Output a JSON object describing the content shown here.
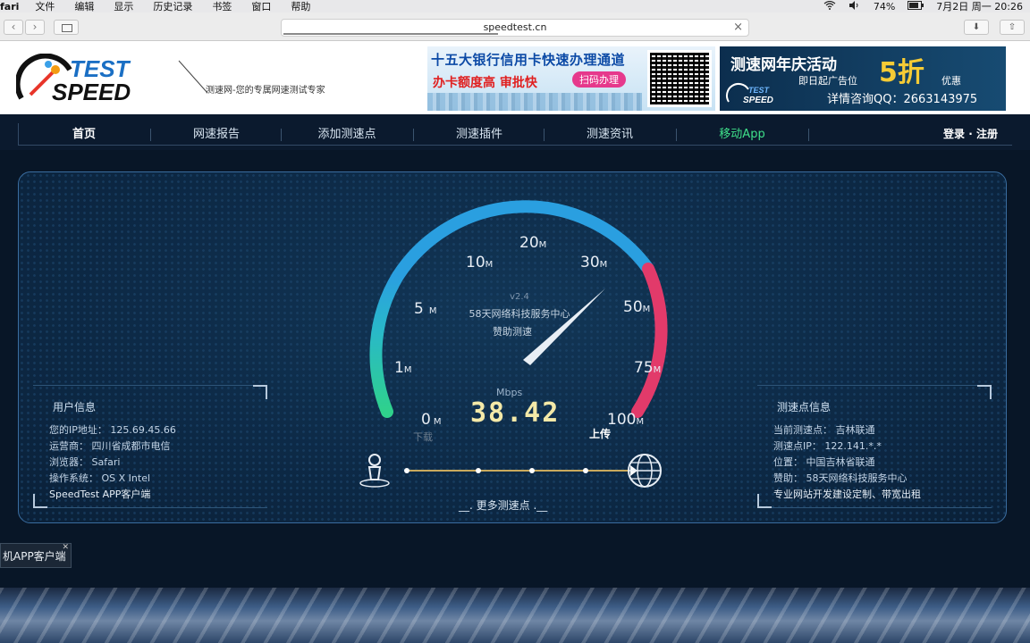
{
  "menubar": {
    "items": [
      "fari",
      "文件",
      "编辑",
      "显示",
      "历史记录",
      "书签",
      "窗口",
      "帮助"
    ],
    "battery": "74%",
    "datetime": "7月2日 周一  20:26"
  },
  "browser": {
    "url": "speedtest.cn"
  },
  "site": {
    "slogan": "测速网-您的专属网速测试专家",
    "logo_line1": "TEST",
    "logo_line2": "SPEED"
  },
  "ads": {
    "ad1_title": "十五大银行信用卡快速办理通道",
    "ad1_sub": "办卡额度高 审批快",
    "ad1_button": "扫码办理",
    "ad2_title": "测速网年庆活动",
    "ad2_sub": "即日起广告位",
    "ad2_discount": "5折",
    "ad2_discount_suffix": "优惠",
    "ad2_contact": "详情咨询QQ：2663143975"
  },
  "nav": {
    "items": [
      "首页",
      "网速报告",
      "添加测速点",
      "测速插件",
      "测速资讯",
      "移动App"
    ],
    "login": "登录",
    "register": "注册"
  },
  "gauge": {
    "version": "v2.4",
    "sponsor_line1": "58天网络科技服务中心",
    "sponsor_line2": "赞助测速",
    "unit": "Mbps",
    "speed": "38.42",
    "download_label": "下载",
    "upload_label": "上传",
    "ticks": [
      {
        "num": "0",
        "unit": "M"
      },
      {
        "num": "1",
        "unit": "M"
      },
      {
        "num": "5",
        "unit": "M"
      },
      {
        "num": "10",
        "unit": "M"
      },
      {
        "num": "20",
        "unit": "M"
      },
      {
        "num": "30",
        "unit": "M"
      },
      {
        "num": "50",
        "unit": "M"
      },
      {
        "num": "75",
        "unit": "M"
      },
      {
        "num": "100",
        "unit": "M"
      }
    ],
    "colors": {
      "green": "#2fd18c",
      "blue": "#2a9fe0",
      "red": "#e23a6a"
    }
  },
  "user_info": {
    "title": "用户信息",
    "ip": "您的IP地址： 125.69.45.66",
    "isp": "运营商： 四川省成都市电信",
    "browser": "浏览器： Safari",
    "os": "操作系统： OS X Intel",
    "client": "SpeedTest APP客户端"
  },
  "server_info": {
    "title": "测速点信息",
    "current": "当前测速点： 吉林联通",
    "ip": "测速点IP： 122.141.*.*",
    "location": "位置： 中国吉林省联通",
    "sponsor": "赞助： 58天网络科技服务中心",
    "service": "专业网站开发建设定制、带宽出租"
  },
  "more_points": "__. 更多测速点 .__",
  "bottom_tab": "机APP客户端"
}
